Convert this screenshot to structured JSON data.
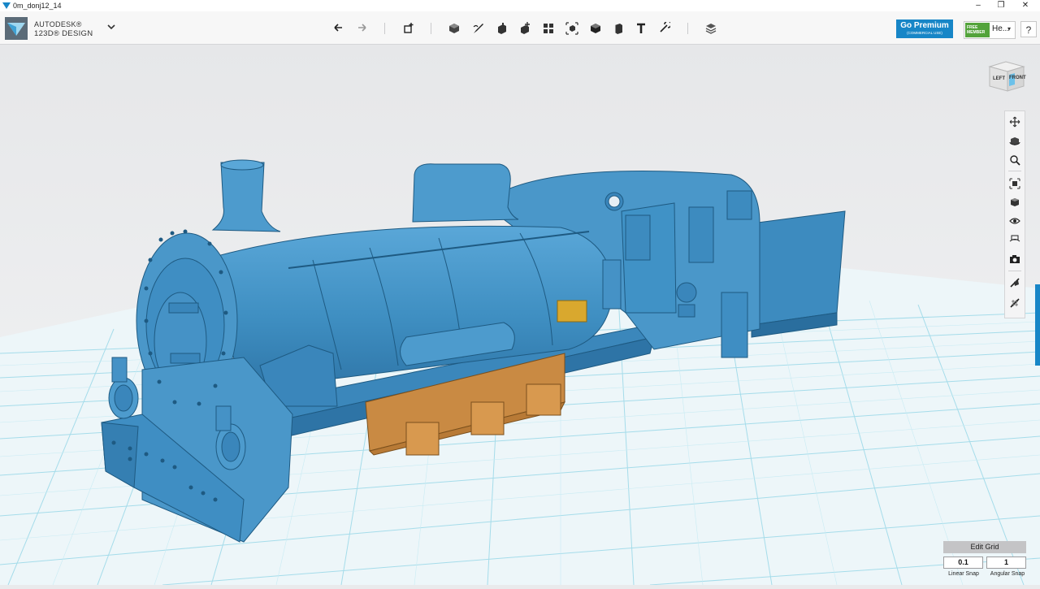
{
  "window": {
    "title": "0m_donj12_14"
  },
  "brand": {
    "line1": "AUTODESK®",
    "line2": "123D® DESIGN"
  },
  "toolbar": {
    "tools": [
      "undo-icon",
      "redo-icon",
      "transform-icon",
      "primitives-icon",
      "sketch-icon",
      "construct-icon",
      "modify-icon",
      "pattern-icon",
      "grouping-icon",
      "combine-icon",
      "measure-icon",
      "text-icon",
      "snap-icon",
      "materials-icon"
    ]
  },
  "account": {
    "premium_label": "Go Premium",
    "premium_sub": "(COMMERCIAL USE)",
    "badge": "FREE MEMBER",
    "user": "He...",
    "help": "?"
  },
  "viewcube": {
    "left": "LEFT",
    "front": "FRONT"
  },
  "navbar": {
    "tools": [
      "pan-icon",
      "orbit-icon",
      "zoom-icon",
      "fit-icon",
      "view-mode-icon",
      "visibility-icon",
      "materials-view-icon",
      "camera-icon",
      "snap-view-icon",
      "show-grid-icon"
    ]
  },
  "grid": {
    "edit_label": "Edit Grid",
    "linear_snap": "0.1",
    "angular_snap": "1",
    "linear_label": "Linear Snap",
    "angular_label": "Angular Snap"
  },
  "colors": {
    "model_blue": "#4a97c9",
    "model_orange": "#c98a43",
    "accent": "#1786c7",
    "grid_line": "#8ed3e5"
  }
}
